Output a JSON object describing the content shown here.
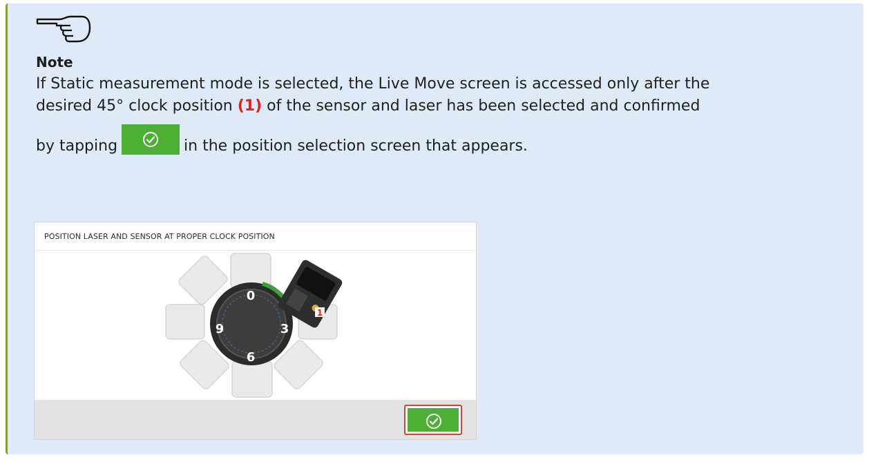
{
  "note": {
    "title": "Note",
    "line1": "If Static measurement mode is selected, the Live Move screen is accessed only after the",
    "line2_pre": "desired 45° clock position ",
    "ref_label": "(1)",
    "line2_post": " of the sensor and laser has been selected and confirmed",
    "line3_pre": "by tapping",
    "line3_post": "in the position selection screen that appears."
  },
  "screen": {
    "title": "POSITION LASER AND SENSOR AT PROPER CLOCK POSITION",
    "clock_labels": {
      "twelve": "0",
      "three": "3",
      "six": "6",
      "nine": "9"
    },
    "callout": "1"
  },
  "icons": {
    "note": "pointing-hand-icon",
    "confirm": "check-circle-icon"
  },
  "colors": {
    "note_background": "#dfeaf8",
    "confirm_green": "#4caf33",
    "reference_red": "#e02020"
  }
}
